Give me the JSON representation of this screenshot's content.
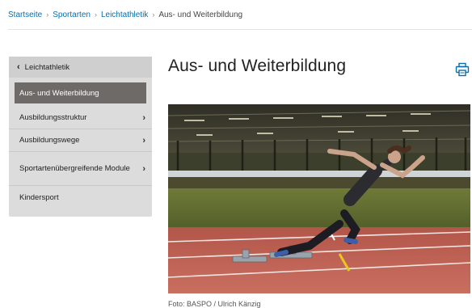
{
  "breadcrumb": {
    "items": [
      "Startseite",
      "Sportarten",
      "Leichtathletik"
    ],
    "current": "Aus- und Weiterbildung",
    "separator": "›"
  },
  "sidenav": {
    "back_label": "Leichtathletik",
    "items": [
      {
        "label": "Aus- und Weiterbildung",
        "active": true,
        "has_children": false
      },
      {
        "label": "Ausbildungsstruktur",
        "active": false,
        "has_children": true
      },
      {
        "label": "Ausbildungswege",
        "active": false,
        "has_children": true
      },
      {
        "label": "Sportartenübergreifende Module",
        "active": false,
        "has_children": true
      },
      {
        "label": "Kindersport",
        "active": false,
        "has_children": false
      }
    ]
  },
  "main": {
    "title": "Aus- und Weiterbildung",
    "print_icon": "printer-icon",
    "image_caption": "Foto: BASPO / Ulrich Känzig"
  },
  "colors": {
    "link": "#0a6ea9",
    "sidenav_bg": "#dcdcdc",
    "sidenav_active": "#6e6a68",
    "track_red": "#b3564a"
  }
}
